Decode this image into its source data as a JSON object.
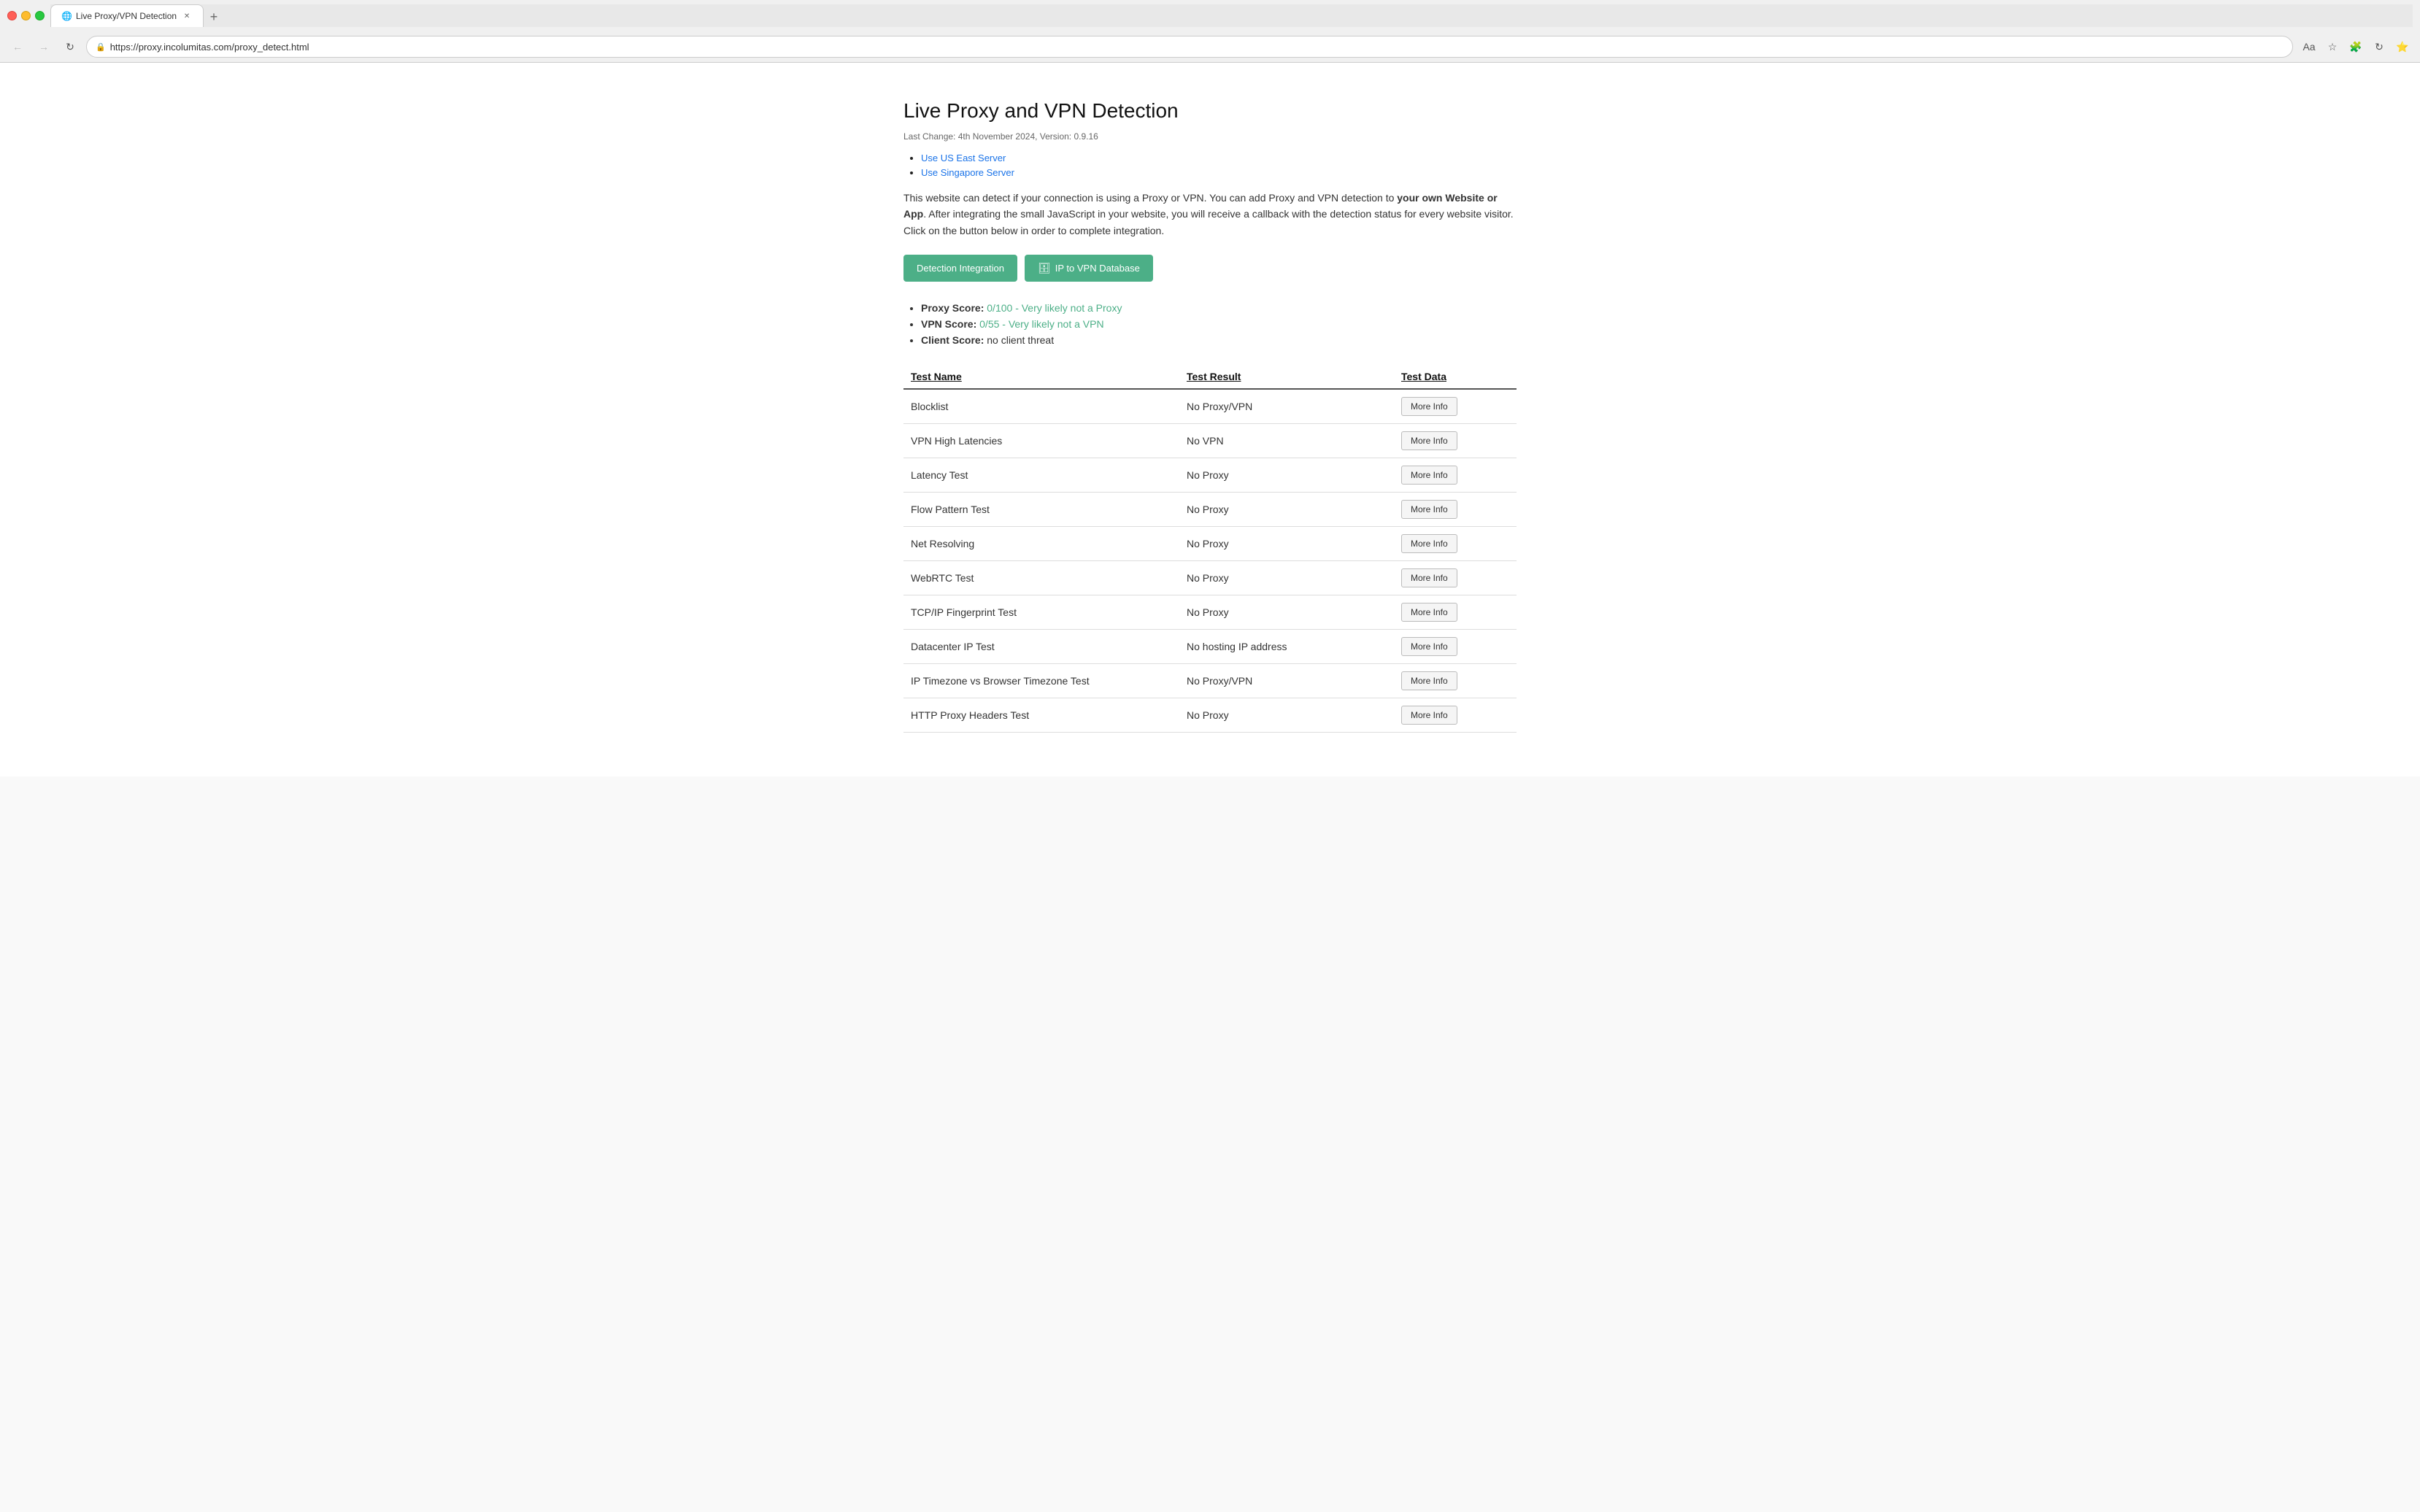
{
  "browser": {
    "tab_title": "Live Proxy/VPN Detection",
    "url": "https://proxy.incolumitas.com/proxy_detect.html",
    "new_tab_label": "+"
  },
  "page": {
    "title": "Live Proxy and VPN Detection",
    "last_change": "Last Change: 4th November 2024, Version: 0.9.16",
    "server_links": [
      {
        "label": "Use US East Server",
        "href": "#"
      },
      {
        "label": "Use Singapore Server",
        "href": "#"
      }
    ],
    "description_part1": "This website can detect if your connection is using a Proxy or VPN. You can add Proxy and VPN detection to ",
    "description_bold": "your own Website or App",
    "description_part2": ". After integrating the small JavaScript in your website, you will receive a callback with the detection status for every website visitor. Click on the button below in order to complete integration.",
    "btn_detection_label": "Detection Integration",
    "btn_database_label": "IP to VPN Database",
    "scores": [
      {
        "label": "Proxy Score:",
        "value": "0/100 - Very likely not a Proxy"
      },
      {
        "label": "VPN Score:",
        "value": "0/55 - Very likely not a VPN"
      },
      {
        "label": "Client Score:",
        "value": "no client threat"
      }
    ],
    "table": {
      "headers": [
        "Test Name",
        "Test Result",
        "Test Data"
      ],
      "rows": [
        {
          "name": "Blocklist",
          "result": "No Proxy/VPN",
          "btn": "More Info"
        },
        {
          "name": "VPN High Latencies",
          "result": "No VPN",
          "btn": "More Info"
        },
        {
          "name": "Latency Test",
          "result": "No Proxy",
          "btn": "More Info"
        },
        {
          "name": "Flow Pattern Test",
          "result": "No Proxy",
          "btn": "More Info"
        },
        {
          "name": "Net Resolving",
          "result": "No Proxy",
          "btn": "More Info"
        },
        {
          "name": "WebRTC Test",
          "result": "No Proxy",
          "btn": "More Info"
        },
        {
          "name": "TCP/IP Fingerprint Test",
          "result": "No Proxy",
          "btn": "More Info"
        },
        {
          "name": "Datacenter IP Test",
          "result": "No hosting IP address",
          "btn": "More Info"
        },
        {
          "name": "IP Timezone vs Browser Timezone Test",
          "result": "No Proxy/VPN",
          "btn": "More Info"
        },
        {
          "name": "HTTP Proxy Headers Test",
          "result": "No Proxy",
          "btn": "More Info"
        }
      ]
    }
  }
}
